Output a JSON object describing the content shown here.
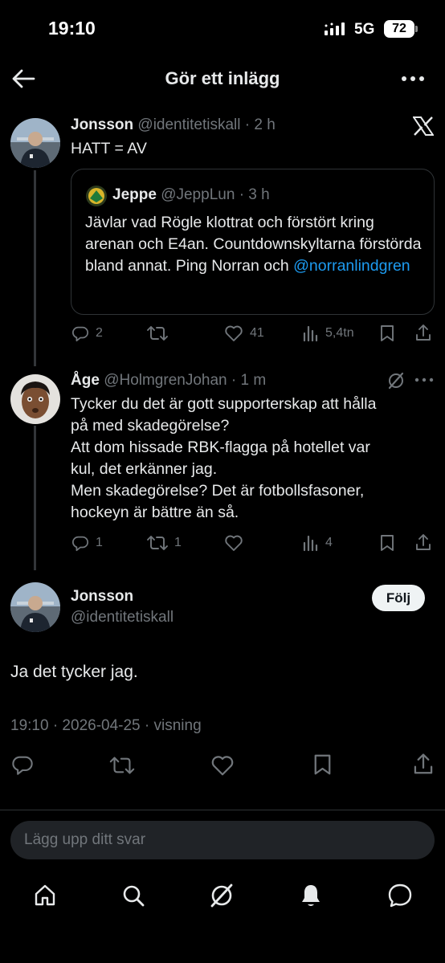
{
  "status_bar": {
    "time": "19:10",
    "network": "5G",
    "battery": "72"
  },
  "header": {
    "title": "Gör ett inlägg"
  },
  "post1": {
    "name": "Jonsson",
    "handle": "@identitetiskall",
    "time": "· 2 h",
    "text": "HATT = AV",
    "quote": {
      "name": "Jeppe",
      "handle": "@JeppLun",
      "time": "· 3 h",
      "text": "Jävlar vad Rögle klottrat och förstört kring arenan och E4an. Countdownskyltarna förstörda bland annat. Ping Norran och",
      "mention": "@norranlindgren"
    },
    "actions": {
      "replies": "2",
      "reposts": "",
      "likes": "41",
      "views": "5,4tn"
    }
  },
  "post2": {
    "name": "Åge",
    "handle": "@HolmgrenJohan",
    "time": "· 1 m",
    "lines": [
      "Tycker du det är gott supporterskap att hålla",
      "på med skadegörelse?",
      "Att dom hissade RBK-flagga på hotellet var",
      "kul, det erkänner jag.",
      "Men skadegörelse? Det är fotbollsfasoner,",
      "hockeyn är bättre än så."
    ],
    "actions": {
      "replies": "1",
      "reposts": "1",
      "likes": "",
      "views": "4"
    }
  },
  "main_post": {
    "name": "Jonsson",
    "handle": "@identitetiskall",
    "follow_label": "Följ",
    "text": "Ja det tycker jag.",
    "meta": "19:10 · 2026-04-25 · visning"
  },
  "reply": {
    "placeholder": "Lägg upp ditt svar"
  },
  "colors": {
    "background": "#000000",
    "text": "#e7e9ea",
    "muted": "#71767b",
    "link": "#1d9bf0",
    "divider": "#2f3336"
  },
  "icons": [
    "back-arrow-icon",
    "more-icon",
    "x-logo-icon",
    "reply-icon",
    "repost-icon",
    "like-icon",
    "views-icon",
    "bookmark-icon",
    "share-icon",
    "grok-icon",
    "home-icon",
    "search-icon",
    "bell-icon",
    "messages-icon"
  ]
}
